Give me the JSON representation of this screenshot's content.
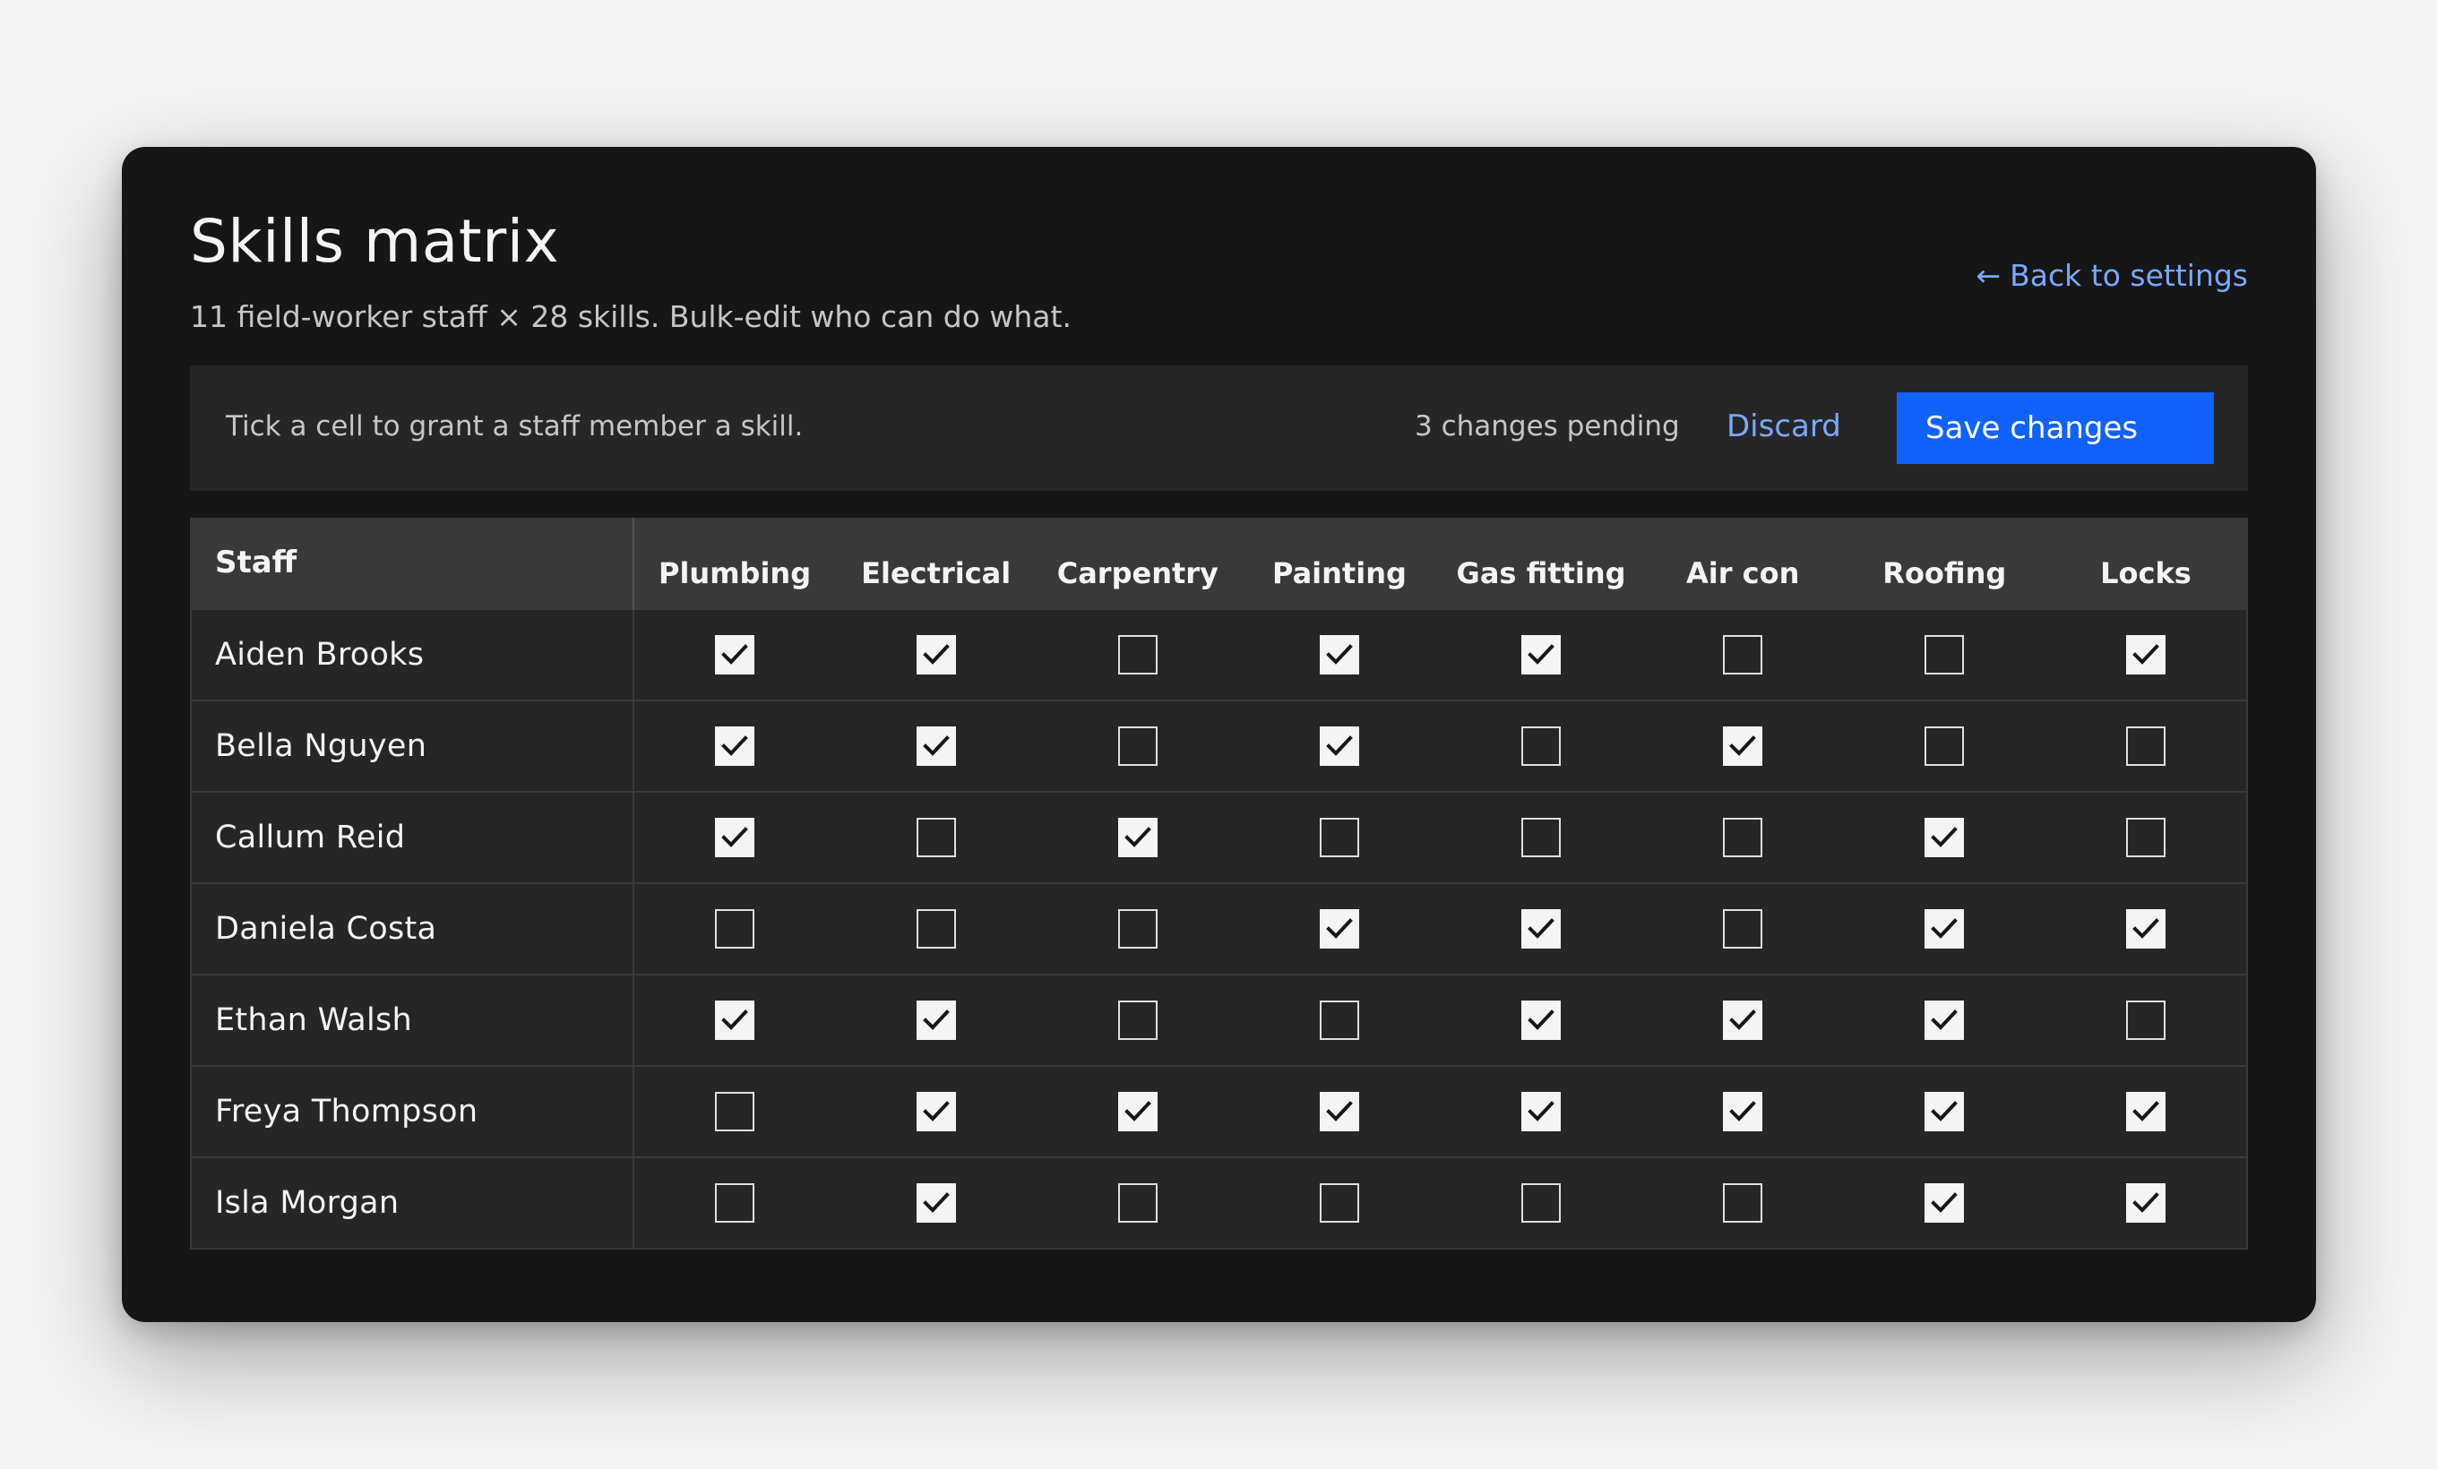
{
  "header": {
    "title": "Skills matrix",
    "subtitle": "11 field-worker staff × 28 skills. Bulk-edit who can do what.",
    "back_arrow": "←",
    "back_label": "Back to settings"
  },
  "toolbar": {
    "hint": "Tick a cell to grant a staff member a skill.",
    "pending": "3 changes pending",
    "discard_label": "Discard",
    "save_label": "Save changes"
  },
  "colors": {
    "accent": "#0f62fe",
    "link": "#78a9ff",
    "background": "#161616"
  },
  "matrix": {
    "staff_header": "Staff",
    "skills": [
      "Plumbing",
      "Electrical",
      "Carpentry",
      "Painting",
      "Gas fitting",
      "Air con",
      "Roofing",
      "Locks"
    ],
    "rows": [
      {
        "name": "Aiden Brooks",
        "skills": [
          true,
          true,
          false,
          true,
          true,
          false,
          false,
          true
        ]
      },
      {
        "name": "Bella Nguyen",
        "skills": [
          true,
          true,
          false,
          true,
          false,
          true,
          false,
          false
        ]
      },
      {
        "name": "Callum Reid",
        "skills": [
          true,
          false,
          true,
          false,
          false,
          false,
          true,
          false
        ]
      },
      {
        "name": "Daniela Costa",
        "skills": [
          false,
          false,
          false,
          true,
          true,
          false,
          true,
          true
        ]
      },
      {
        "name": "Ethan Walsh",
        "skills": [
          true,
          true,
          false,
          false,
          true,
          true,
          true,
          false
        ]
      },
      {
        "name": "Freya Thompson",
        "skills": [
          false,
          true,
          true,
          true,
          true,
          true,
          true,
          true
        ]
      },
      {
        "name": "Isla Morgan",
        "skills": [
          false,
          true,
          false,
          false,
          false,
          false,
          true,
          true
        ]
      }
    ]
  }
}
